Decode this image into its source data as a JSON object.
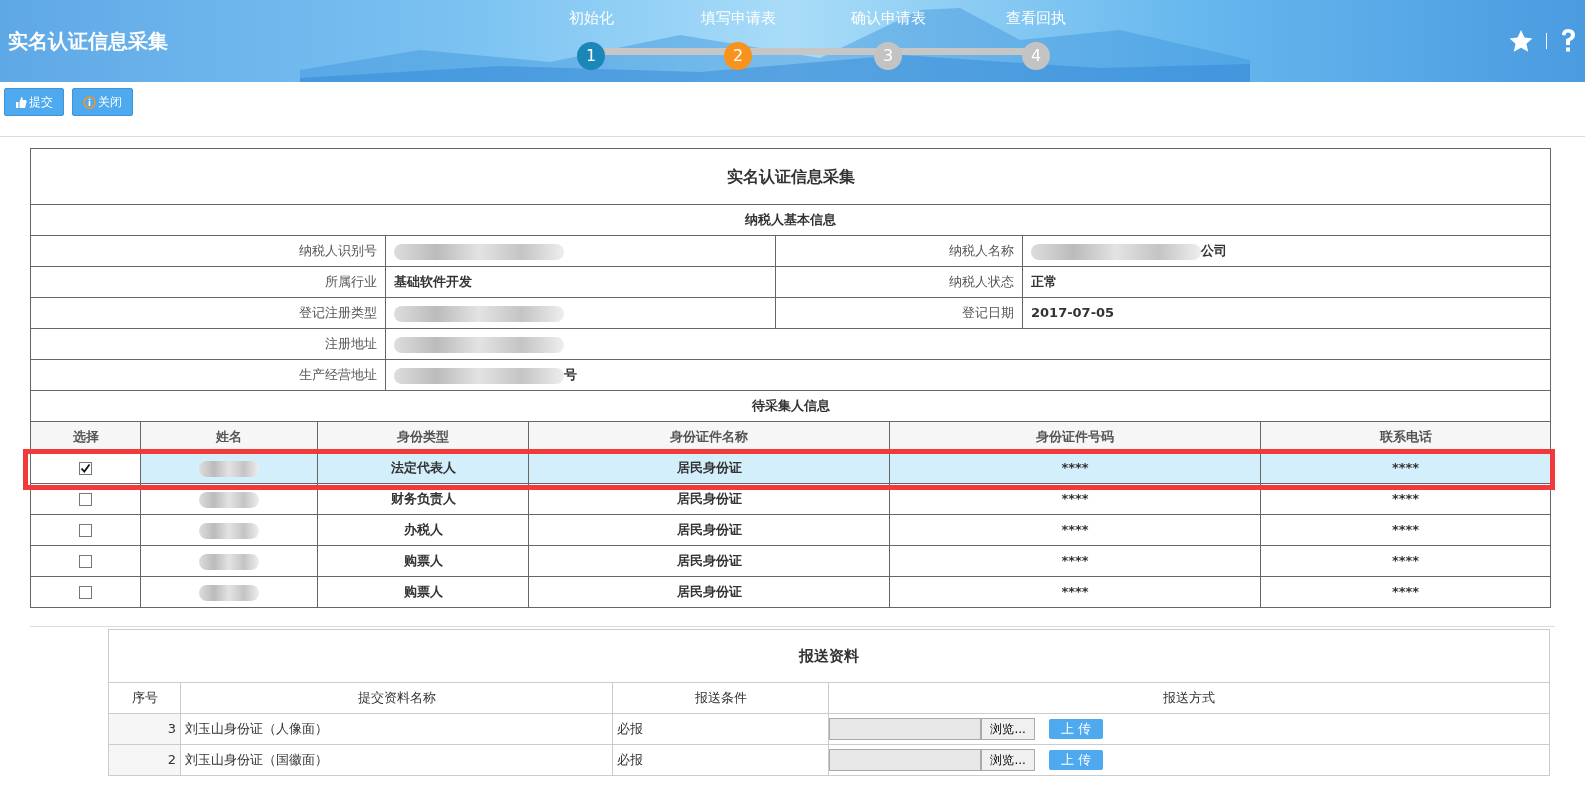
{
  "header": {
    "title": "实名认证信息采集",
    "steps": [
      {
        "number": "1",
        "label": "初始化",
        "done": true,
        "selected": false
      },
      {
        "number": "2",
        "label": "填写申请表",
        "done": false,
        "selected": true
      },
      {
        "number": "3",
        "label": "确认申请表",
        "done": false,
        "selected": false
      },
      {
        "number": "4",
        "label": "查看回执",
        "done": false,
        "selected": false
      }
    ],
    "icons": [
      {
        "kind": "star"
      },
      {
        "kind": "help"
      }
    ]
  },
  "toolbar": [
    {
      "label": "提交",
      "kind": "thumb"
    },
    {
      "label": "关闭",
      "kind": "info"
    }
  ],
  "form": {
    "title": "实名认证信息采集",
    "section": "纳税人基本信息",
    "field_rows": [
      [
        {
          "label": "纳税人识别号",
          "redacted": true
        },
        {
          "label": "纳税人名称",
          "value": "公司",
          "redacted": true
        }
      ],
      [
        {
          "label": "所属行业",
          "value": "基础软件开发",
          "redacted": false
        },
        {
          "label": "纳税人状态",
          "value": "正常",
          "redacted": false
        }
      ],
      [
        {
          "label": "登记注册类型",
          "redacted": true
        },
        {
          "label": "登记日期",
          "value": "2017-07-05",
          "redacted": false
        }
      ],
      [
        {
          "label": "注册地址",
          "redacted": true
        }
      ],
      [
        {
          "label": "生产经营地址",
          "value": "号",
          "redacted": true
        }
      ]
    ],
    "collector_section": "待采集人信息",
    "columns": [
      "选择",
      "姓名",
      "身份类型",
      "身份证件名称",
      "身份证件号码",
      "联系电话"
    ],
    "collectors": [
      {
        "selected": true,
        "role": "法定代表人",
        "id_type": "居民身份证",
        "id_number": "****",
        "phone": "****"
      },
      {
        "selected": false,
        "role": "财务负责人",
        "id_type": "居民身份证",
        "id_number": "****",
        "phone": "****"
      },
      {
        "selected": false,
        "role": "办税人",
        "id_type": "居民身份证",
        "id_number": "****",
        "phone": "****"
      },
      {
        "selected": false,
        "role": "购票人",
        "id_type": "居民身份证",
        "id_number": "****",
        "phone": "****"
      },
      {
        "selected": false,
        "role": "购票人",
        "id_type": "居民身份证",
        "id_number": "****",
        "phone": "****"
      }
    ]
  },
  "materials": {
    "title": "报送资料",
    "columns": [
      "序号",
      "提交资料名称",
      "报送条件",
      "报送方式"
    ],
    "rows": [
      {
        "index": "3",
        "name": "刘玉山身份证（人像面）",
        "condition": "必报",
        "browse": "浏览...",
        "upload": "上 传"
      },
      {
        "index": "2",
        "name": "刘玉山身份证（国徽面）",
        "condition": "必报",
        "browse": "浏览...",
        "upload": "上 传"
      }
    ]
  }
}
